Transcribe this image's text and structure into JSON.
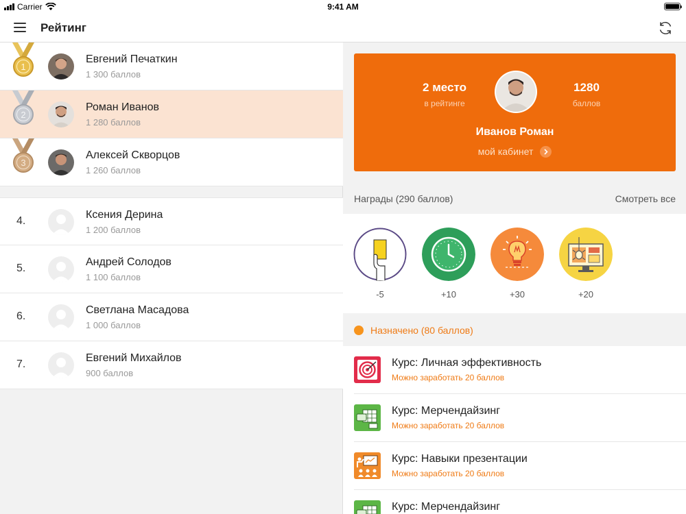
{
  "status_bar": {
    "carrier": "Carrier",
    "time": "9:41 AM"
  },
  "nav": {
    "title": "Рейтинг",
    "menu_icon": "hamburger-icon",
    "refresh_icon": "refresh-icon"
  },
  "leaderboard": [
    {
      "rank": "1",
      "name": "Евгений Печаткин",
      "score": "1 300 баллов",
      "medal": "gold",
      "selected": false
    },
    {
      "rank": "2",
      "name": "Роман Иванов",
      "score": "1 280 баллов",
      "medal": "silver",
      "selected": true
    },
    {
      "rank": "3",
      "name": "Алексей Скворцов",
      "score": "1 260 баллов",
      "medal": "bronze",
      "selected": false
    },
    {
      "rank": "4.",
      "name": "Ксения Дерина",
      "score": "1 200 баллов"
    },
    {
      "rank": "5.",
      "name": "Андрей Солодов",
      "score": "1 100 баллов"
    },
    {
      "rank": "6.",
      "name": "Светлана Масадова",
      "score": "1 000 баллов"
    },
    {
      "rank": "7.",
      "name": "Евгений Михайлов",
      "score": "900 баллов"
    }
  ],
  "profile": {
    "place_value": "2 место",
    "place_label": "в рейтинге",
    "points_value": "1280",
    "points_label": "баллов",
    "name": "Иванов Роман",
    "cabinet_link": "мой кабинет",
    "card_color": "#ef6c0c"
  },
  "awards": {
    "title": "Награды (290 баллов)",
    "see_all": "Смотреть все",
    "items": [
      {
        "points": "-5",
        "icon": "yellow-card-icon"
      },
      {
        "points": "+10",
        "icon": "clock-icon"
      },
      {
        "points": "+30",
        "icon": "lightbulb-icon"
      },
      {
        "points": "+20",
        "icon": "monitor-bug-icon"
      }
    ]
  },
  "assigned": {
    "title": "Назначено (80 баллов)",
    "courses": [
      {
        "title": "Курс: Личная эффективность",
        "subtitle": "Можно заработать 20 баллов",
        "icon": "target-icon"
      },
      {
        "title": "Курс: Мерчендайзинг",
        "subtitle": "Можно заработать 20 баллов",
        "icon": "shelf-icon"
      },
      {
        "title": "Курс: Навыки презентации",
        "subtitle": "Можно заработать 20 баллов",
        "icon": "presentation-icon"
      },
      {
        "title": "Курс: Мерчендайзинг",
        "subtitle": "",
        "icon": "shelf-icon"
      }
    ]
  }
}
